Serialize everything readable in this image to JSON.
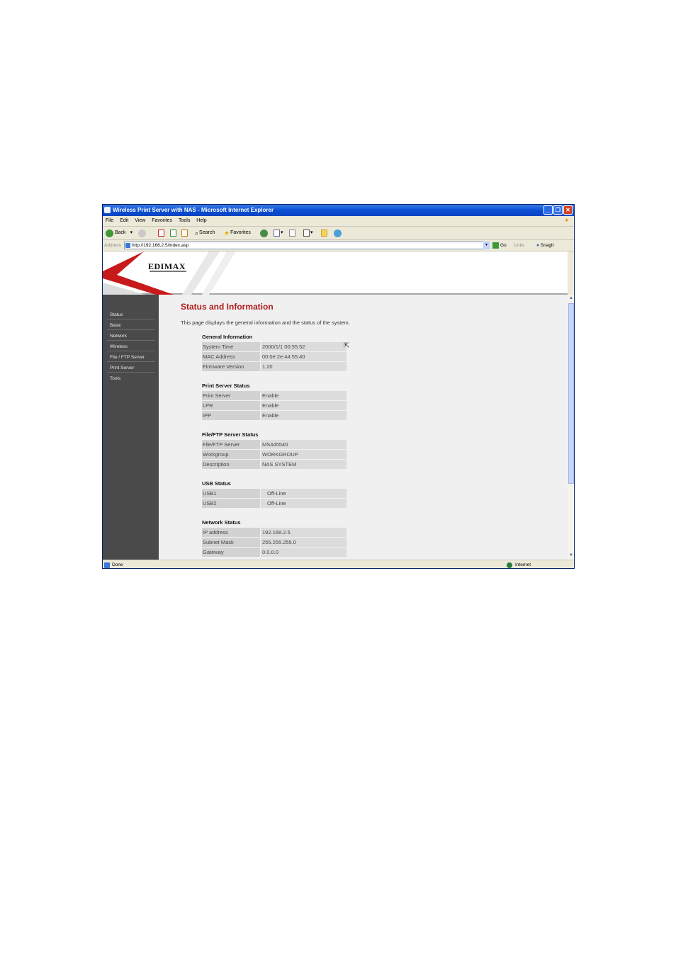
{
  "window": {
    "title": "Wireless Print Server with NAS - Microsoft Internet Explorer"
  },
  "menu": [
    "File",
    "Edit",
    "View",
    "Favorites",
    "Tools",
    "Help"
  ],
  "toolbar": {
    "back": "Back",
    "search": "Search",
    "favorites": "Favorites"
  },
  "address": {
    "label": "Address",
    "url": "http://192.168.2.5/index.asp",
    "go": "Go",
    "links": "Links",
    "snagit": "SnagIt"
  },
  "brand": "EDIMAX",
  "nav": [
    "Status",
    "Basic",
    "Network",
    "Wireless",
    "File / FTP Server",
    "Print Server",
    "Tools"
  ],
  "page": {
    "title": "Status and Information",
    "description": "This page displays the general information and the status of the system."
  },
  "sections": [
    {
      "title": "General Information",
      "rows": [
        [
          "System Time",
          "2000/1/1 00:55:52"
        ],
        [
          "MAC Address",
          "00:0e:2e:44:55:40"
        ],
        [
          "Firmware Version",
          "1.20"
        ]
      ]
    },
    {
      "title": "Print Server Status",
      "rows": [
        [
          "Print Server",
          "Enable"
        ],
        [
          "LPR",
          "Enable"
        ],
        [
          "IPP",
          "Enable"
        ]
      ]
    },
    {
      "title": "File/FTP Server Status",
      "rows": [
        [
          "File/FTP Server",
          "MS445540"
        ],
        [
          "Workgroup",
          "WORKGROUP"
        ],
        [
          "Description",
          "NAS SYSTEM"
        ]
      ]
    },
    {
      "title": "USB Status",
      "rows": [
        [
          "USB1",
          "Off-Line"
        ],
        [
          "USB2",
          "Off-Line"
        ]
      ]
    },
    {
      "title": "Network Status",
      "rows": [
        [
          "IP address",
          "192.168.2.5"
        ],
        [
          "Subnet Mask",
          "255.255.255.0"
        ],
        [
          "Gateway",
          "0.0.0.0"
        ]
      ]
    }
  ],
  "status": {
    "left": "Done",
    "right": "Internet"
  }
}
